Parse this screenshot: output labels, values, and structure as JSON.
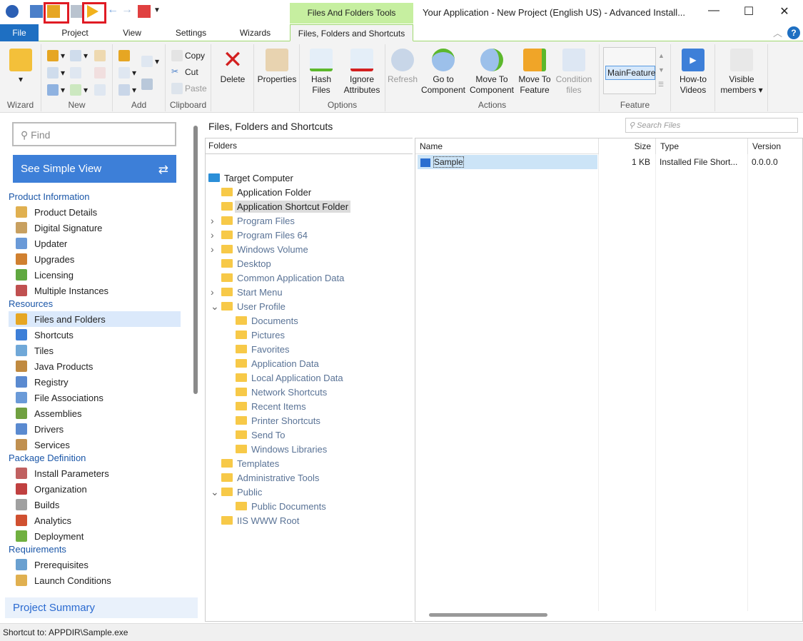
{
  "title_bar": {
    "context_tab": "Files And Folders Tools",
    "title": "Your Application - New Project (English US) - Advanced Install...",
    "minimize": "—",
    "maximize": "☐",
    "close": "✕"
  },
  "tabs": [
    "File",
    "Project",
    "View",
    "Settings",
    "Wizards",
    "Files, Folders and Shortcuts"
  ],
  "ribbon": {
    "groups": {
      "wizard": "Wizard",
      "new": "New",
      "add": "Add",
      "clipboard": "Clipboard",
      "options": "Options",
      "actions": "Actions",
      "feature": "Feature"
    },
    "copy": "Copy",
    "cut": "Cut",
    "paste": "Paste",
    "delete": "Delete",
    "properties": "Properties",
    "hash_files": "Hash Files",
    "ignore_attributes": "Ignore Attributes",
    "refresh": "Refresh",
    "go_to_component": "Go to Component",
    "move_to_component": "Move To Component",
    "move_to_feature": "Move To Feature",
    "condition_files": "Condition files",
    "feature_selected": "MainFeature",
    "howto": "How-to Videos",
    "visible_members": "Visible members ▾"
  },
  "sidebar": {
    "find_placeholder": "Find",
    "simple_view": "See Simple View",
    "summary": "Project Summary",
    "sections": [
      {
        "label": "Product Information",
        "items": [
          "Product Details",
          "Digital Signature",
          "Updater",
          "Upgrades",
          "Licensing",
          "Multiple Instances"
        ]
      },
      {
        "label": "Resources",
        "items": [
          "Files and Folders",
          "Shortcuts",
          "Tiles",
          "Java Products",
          "Registry",
          "File Associations",
          "Assemblies",
          "Drivers",
          "Services"
        ]
      },
      {
        "label": "Package Definition",
        "items": [
          "Install Parameters",
          "Organization",
          "Builds",
          "Analytics",
          "Deployment"
        ]
      },
      {
        "label": "Requirements",
        "items": [
          "Prerequisites",
          "Launch Conditions"
        ]
      }
    ],
    "selected": "Files and Folders"
  },
  "main": {
    "title": "Files, Folders and Shortcuts",
    "search_placeholder": "Search Files",
    "folders_header": "Folders",
    "tree": [
      {
        "label": "Target Computer",
        "level": 0,
        "exp": ""
      },
      {
        "label": "Application Folder",
        "level": 1,
        "exp": ""
      },
      {
        "label": "Application Shortcut Folder",
        "level": 1,
        "exp": "",
        "selected": true
      },
      {
        "label": "Program Files",
        "level": 1,
        "exp": ">",
        "dim": true
      },
      {
        "label": "Program Files 64",
        "level": 1,
        "exp": ">",
        "dim": true
      },
      {
        "label": "Windows Volume",
        "level": 1,
        "exp": ">",
        "dim": true
      },
      {
        "label": "Desktop",
        "level": 1,
        "exp": "",
        "dim": true
      },
      {
        "label": "Common Application Data",
        "level": 1,
        "exp": "",
        "dim": true
      },
      {
        "label": "Start Menu",
        "level": 1,
        "exp": ">",
        "dim": true
      },
      {
        "label": "User Profile",
        "level": 1,
        "exp": "v",
        "dim": true
      },
      {
        "label": "Documents",
        "level": 2,
        "exp": "",
        "dim": true
      },
      {
        "label": "Pictures",
        "level": 2,
        "exp": "",
        "dim": true
      },
      {
        "label": "Favorites",
        "level": 2,
        "exp": "",
        "dim": true
      },
      {
        "label": "Application Data",
        "level": 2,
        "exp": "",
        "dim": true
      },
      {
        "label": "Local Application Data",
        "level": 2,
        "exp": "",
        "dim": true
      },
      {
        "label": "Network Shortcuts",
        "level": 2,
        "exp": "",
        "dim": true
      },
      {
        "label": "Recent Items",
        "level": 2,
        "exp": "",
        "dim": true
      },
      {
        "label": "Printer Shortcuts",
        "level": 2,
        "exp": "",
        "dim": true
      },
      {
        "label": "Send To",
        "level": 2,
        "exp": "",
        "dim": true
      },
      {
        "label": "Windows Libraries",
        "level": 2,
        "exp": "",
        "dim": true
      },
      {
        "label": "Templates",
        "level": 1,
        "exp": "",
        "dim": true
      },
      {
        "label": "Administrative Tools",
        "level": 1,
        "exp": "",
        "dim": true
      },
      {
        "label": "Public",
        "level": 1,
        "exp": "v",
        "dim": true
      },
      {
        "label": "Public Documents",
        "level": 2,
        "exp": "",
        "dim": true
      },
      {
        "label": "IIS WWW Root",
        "level": 1,
        "exp": "",
        "dim": true
      }
    ],
    "columns": {
      "name": "Name",
      "size": "Size",
      "type": "Type",
      "version": "Version"
    },
    "files": [
      {
        "name": "Sample",
        "size": "1 KB",
        "type": "Installed File Short...",
        "version": "0.0.0.0"
      }
    ]
  },
  "status": "Shortcut to: APPDIR\\Sample.exe"
}
